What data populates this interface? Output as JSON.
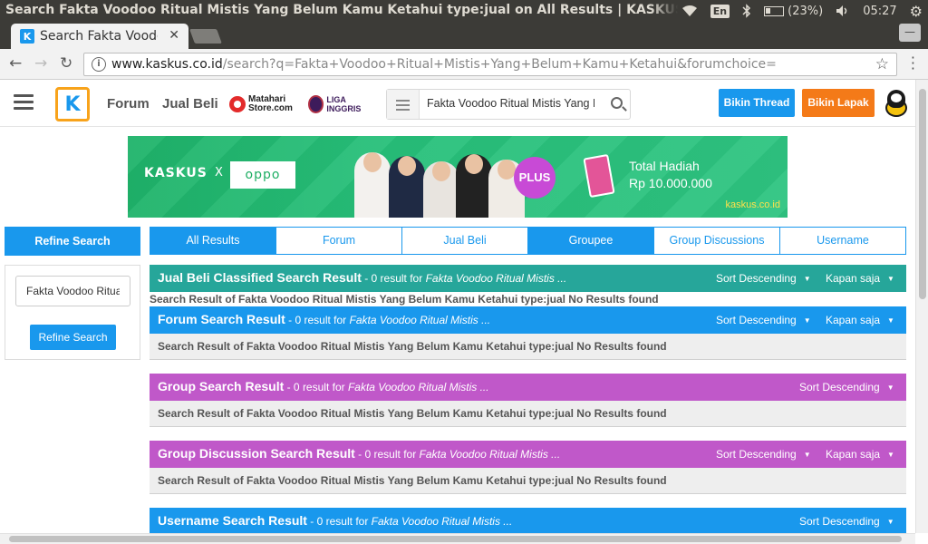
{
  "window": {
    "title": "Search Fakta Voodoo Ritual Mistis Yang Belum Kamu Ketahui type:jual on All Results | KASKUS - Chrome",
    "lang": "En",
    "battery": "(23%)",
    "time": "05:27"
  },
  "browser": {
    "tab_title": "Search Fakta Voodoo",
    "url_host": "www.kaskus.co.id",
    "url_path": "/search?q=Fakta+Voodoo+Ritual+Mistis+Yang+Belum+Kamu+Ketahui&forumchoice="
  },
  "header": {
    "logo": "K",
    "nav_forum": "Forum",
    "nav_jualbeli": "Jual Beli",
    "matahari_line1": "Matahari",
    "matahari_line2": "Store.com",
    "liga": "LIGA INGGRIS",
    "search_value": "Fakta Voodoo Ritual Mistis Yang Belum Kamu Ketahui",
    "bikin_thread": "Bikin Thread",
    "bikin_lapak": "Bikin Lapak"
  },
  "banner": {
    "kaskus": "KASKUS",
    "x": "X",
    "oppo": "oppo",
    "plus": "PLUS",
    "hadiah_title": "Total Hadiah",
    "hadiah_value": "Rp 10.000.000",
    "site": "kaskus.co.id"
  },
  "sidebar": {
    "heading": "Refine Search",
    "input_value": "Fakta Voodoo Ritual Mistis Yang Belum Kamu Ketahui",
    "button": "Refine Search"
  },
  "tabs": [
    {
      "label": "All Results",
      "active": true
    },
    {
      "label": "Forum",
      "active": false
    },
    {
      "label": "Jual Beli",
      "active": false
    },
    {
      "label": "Groupee",
      "active": true
    },
    {
      "label": "Group Discussions",
      "active": false
    },
    {
      "label": "Username",
      "active": false
    }
  ],
  "sections": {
    "jual": {
      "title": "Jual Beli Classified Search Result",
      "sub": " - 0 result for ",
      "query": "Fakta Voodoo Ritual Mistis ...",
      "sort": "Sort Descending",
      "kapan": "Kapan saja",
      "empty": "Search Result of Fakta Voodoo Ritual Mistis Yang Belum Kamu Ketahui type:jual No Results found"
    },
    "forum": {
      "title": "Forum Search Result",
      "sub": " - 0 result for ",
      "query": "Fakta Voodoo Ritual Mistis ...",
      "sort": "Sort Descending",
      "kapan": "Kapan saja",
      "empty": "Search Result of Fakta Voodoo Ritual Mistis Yang Belum Kamu Ketahui type:jual No Results found"
    },
    "group": {
      "title": "Group Search Result",
      "sub": " - 0 result for ",
      "query": "Fakta Voodoo Ritual Mistis ...",
      "sort": "Sort Descending",
      "empty": "Search Result of Fakta Voodoo Ritual Mistis Yang Belum Kamu Ketahui type:jual No Results found"
    },
    "discussion": {
      "title": "Group Discussion Search Result",
      "sub": " - 0 result for ",
      "query": "Fakta Voodoo Ritual Mistis ...",
      "sort": "Sort Descending",
      "kapan": "Kapan saja",
      "empty": "Search Result of Fakta Voodoo Ritual Mistis Yang Belum Kamu Ketahui type:jual No Results found"
    },
    "username": {
      "title": "Username Search Result",
      "sub": " - 0 result for ",
      "query": "Fakta Voodoo Ritual Mistis ...",
      "sort": "Sort Descending"
    }
  },
  "colors": {
    "jual": "#26a69a",
    "forum": "#1998ed",
    "group": "#c058c9",
    "username": "#1998ed",
    "brand_blue": "#1998ed",
    "brand_orange": "#f47a18"
  },
  "icons": {
    "hamburger": "hamburger-icon",
    "search": "search-icon",
    "info": "info-icon",
    "star": "star-icon",
    "back": "back-arrow-icon",
    "forward": "forward-arrow-icon",
    "reload": "reload-icon",
    "wifi": "wifi-icon",
    "bluetooth": "bluetooth-icon",
    "battery": "battery-icon",
    "volume": "volume-icon",
    "gear": "gear-icon"
  }
}
